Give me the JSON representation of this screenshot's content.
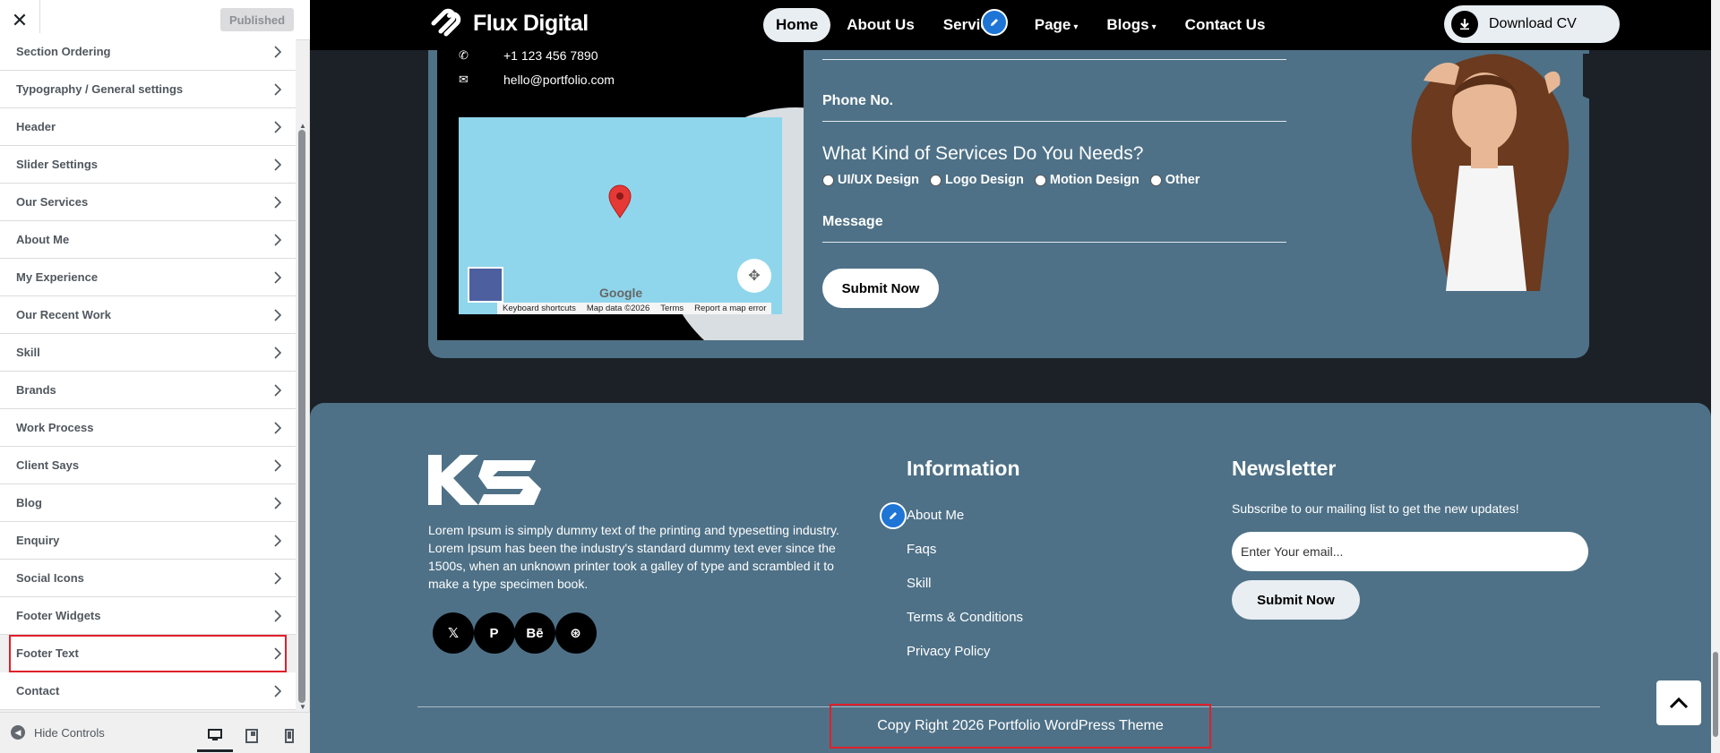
{
  "sidebar": {
    "close_icon": "close-icon",
    "published_label": "Published",
    "items": [
      {
        "label": "Section Ordering"
      },
      {
        "label": "Typography / General settings"
      },
      {
        "label": "Header"
      },
      {
        "label": "Slider Settings"
      },
      {
        "label": "Our Services"
      },
      {
        "label": "About Me"
      },
      {
        "label": "My Experience"
      },
      {
        "label": "Our Recent Work"
      },
      {
        "label": "Skill"
      },
      {
        "label": "Brands"
      },
      {
        "label": "Work Process"
      },
      {
        "label": "Client Says"
      },
      {
        "label": "Blog"
      },
      {
        "label": "Enquiry"
      },
      {
        "label": "Social Icons"
      },
      {
        "label": "Footer Widgets"
      },
      {
        "label": "Footer Text",
        "highlighted": true
      },
      {
        "label": "Contact"
      }
    ],
    "hide_controls_label": "Hide Controls",
    "devices": [
      "desktop",
      "tablet",
      "mobile"
    ],
    "active_device": "desktop"
  },
  "nav": {
    "brand": "Flux Digital",
    "menu": [
      {
        "label": "Home",
        "active": true,
        "dropdown": false
      },
      {
        "label": "About Us",
        "active": false,
        "dropdown": false
      },
      {
        "label": "Services",
        "active": false,
        "dropdown": false
      },
      {
        "label": "Page",
        "active": false,
        "dropdown": true
      },
      {
        "label": "Blogs",
        "active": false,
        "dropdown": true
      },
      {
        "label": "Contact Us",
        "active": false,
        "dropdown": false
      }
    ],
    "download_label": "Download CV"
  },
  "contact": {
    "phone": "+1 123 456 7890",
    "email": "hello@portfolio.com",
    "map": {
      "logo": "Google",
      "links": [
        "Keyboard shortcuts",
        "Map data ©2026",
        "Terms",
        "Report a map error"
      ]
    },
    "form": {
      "phone_label": "Phone No.",
      "services_question": "What Kind of Services Do You Needs?",
      "service_options": [
        "UI/UX Design",
        "Logo Design",
        "Motion Design",
        "Other"
      ],
      "message_label": "Message",
      "submit_label": "Submit Now"
    }
  },
  "footer": {
    "logo": "KS",
    "about_text": "Lorem Ipsum is simply dummy text of the printing and typesetting industry. Lorem Ipsum has been the industry's standard dummy text ever since the 1500s, when an unknown printer took a galley of type and scrambled it to make a type specimen book.",
    "social": [
      {
        "icon": "x-icon",
        "glyph": "𝕏"
      },
      {
        "icon": "pinterest-icon",
        "glyph": "P"
      },
      {
        "icon": "behance-icon",
        "glyph": "Bē"
      },
      {
        "icon": "dribbble-icon",
        "glyph": "⊛"
      }
    ],
    "info_heading": "Information",
    "info_links": [
      "About Me",
      "Faqs",
      "Skill",
      "Terms & Conditions",
      "Privacy Policy"
    ],
    "newsletter_heading": "Newsletter",
    "newsletter_text": "Subscribe to our mailing list to get the new updates!",
    "email_placeholder": "Enter Your email...",
    "submit_label": "Submit Now",
    "copyright": "Copy Right 2026 Portfolio WordPress Theme"
  },
  "colors": {
    "accent": "#4e7187",
    "highlight": "#e0202a",
    "edit_pencil": "#1e75d6"
  }
}
